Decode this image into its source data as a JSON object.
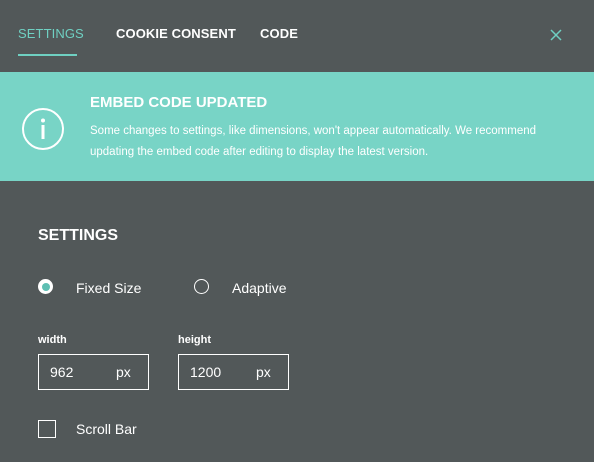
{
  "tabs": [
    {
      "label": "SETTINGS",
      "active": true
    },
    {
      "label": "COOKIE CONSENT",
      "active": false
    },
    {
      "label": "CODE",
      "active": false
    }
  ],
  "banner": {
    "title": "EMBED CODE UPDATED",
    "text": "Some changes to settings, like dimensions, won't appear automatically. We recommend updating the embed code after editing to display the latest version."
  },
  "settings": {
    "title": "SETTINGS",
    "size_options": [
      {
        "label": "Fixed Size",
        "selected": true
      },
      {
        "label": "Adaptive",
        "selected": false
      }
    ],
    "width": {
      "label": "width",
      "value": "962",
      "unit": "px"
    },
    "height": {
      "label": "height",
      "value": "1200",
      "unit": "px"
    },
    "scrollbar": {
      "label": "Scroll Bar",
      "checked": false
    }
  },
  "colors": {
    "background": "#525859",
    "accent": "#6fd0c2",
    "banner": "#78d4c6"
  }
}
